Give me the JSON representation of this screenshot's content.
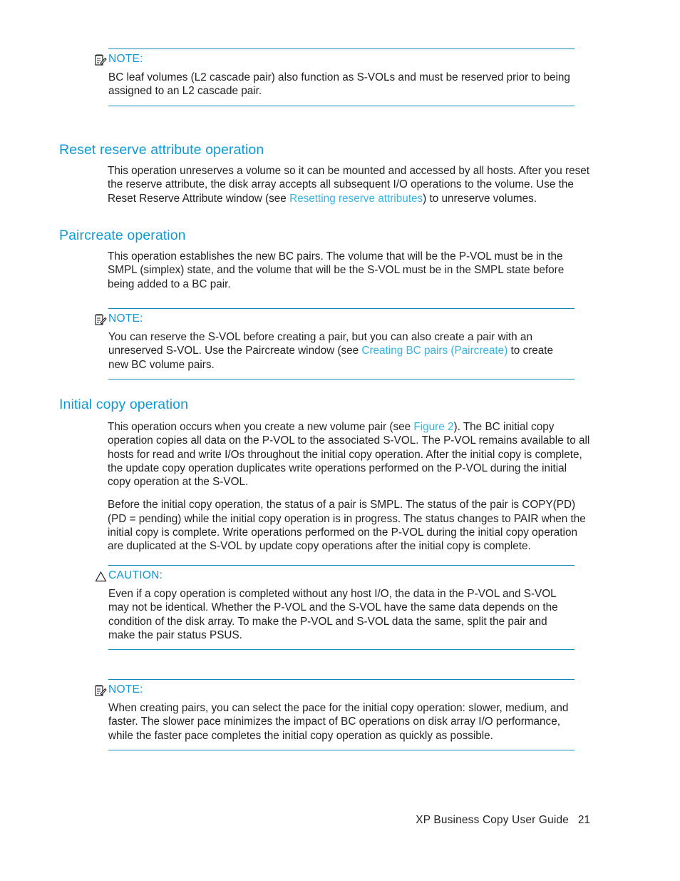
{
  "page": {
    "number": "21",
    "footer_title": "XP Business Copy User Guide"
  },
  "colors": {
    "heading": "#0e9ada",
    "link": "#36b2e8",
    "rule": "#0e84b8",
    "text": "#231f20"
  },
  "notes": {
    "note1": {
      "label": "NOTE:",
      "icon": "note-icon",
      "text": "BC leaf volumes (L2 cascade pair) also function as S-VOLs and must be reserved prior to being assigned to an L2 cascade pair."
    },
    "note2": {
      "label": "NOTE:",
      "icon": "note-icon",
      "text_before": "You can reserve the S-VOL before creating a pair, but you can also create a pair with an unreserved S-VOL. Use the Paircreate window (see ",
      "link": "Creating BC pairs (Paircreate)",
      "text_after": " to create new BC volume pairs."
    },
    "caution1": {
      "label": "CAUTION:",
      "icon": "caution-triangle-icon",
      "text": "Even if a copy operation is completed without any host I/O, the data in the P-VOL and S-VOL may not be identical. Whether the P-VOL and the S-VOL have the same data depends on the condition of the disk array. To make the P-VOL and S-VOL data the same, split the pair and make the pair status PSUS."
    },
    "note3": {
      "label": "NOTE:",
      "icon": "note-icon",
      "text": "When creating pairs, you can select the pace for the initial copy operation: slower, medium, and faster. The slower pace minimizes the impact of BC operations on disk array I/O performance, while the faster pace completes the initial copy operation as quickly as possible."
    }
  },
  "sections": {
    "reset_reserve": {
      "heading": "Reset reserve attribute operation",
      "para1_before": "This operation unreserves a volume so it can be mounted and accessed by all hosts. After you reset the reserve attribute, the disk array accepts all subsequent I/O operations to the volume. Use the Reset Reserve Attribute window (see ",
      "para1_link": "Resetting reserve attributes",
      "para1_after": ") to unreserve volumes."
    },
    "paircreate": {
      "heading": "Paircreate operation",
      "para1": "This operation establishes the new BC pairs. The volume that will be the P-VOL must be in the SMPL (simplex) state, and the volume that will be the S-VOL must be in the SMPL state before being added to a BC pair."
    },
    "initial_copy": {
      "heading": "Initial copy operation",
      "para1_before": "This operation occurs when you create a new volume pair (see ",
      "para1_link": "Figure 2",
      "para1_after": "). The BC initial copy operation copies all data on the P-VOL to the associated S-VOL. The P-VOL remains available to all hosts for read and write I/Os throughout the initial copy operation. After the initial copy is complete, the update copy operation duplicates write operations performed on the P-VOL during the initial copy operation at the S-VOL.",
      "para2": "Before the initial copy operation, the status of a pair is SMPL. The status of the pair is COPY(PD) (PD = pending) while the initial copy operation is in progress. The status changes to PAIR when the initial copy is complete. Write operations performed on the P-VOL during the initial copy operation are duplicated at the S-VOL by update copy operations after the initial copy is complete."
    }
  }
}
